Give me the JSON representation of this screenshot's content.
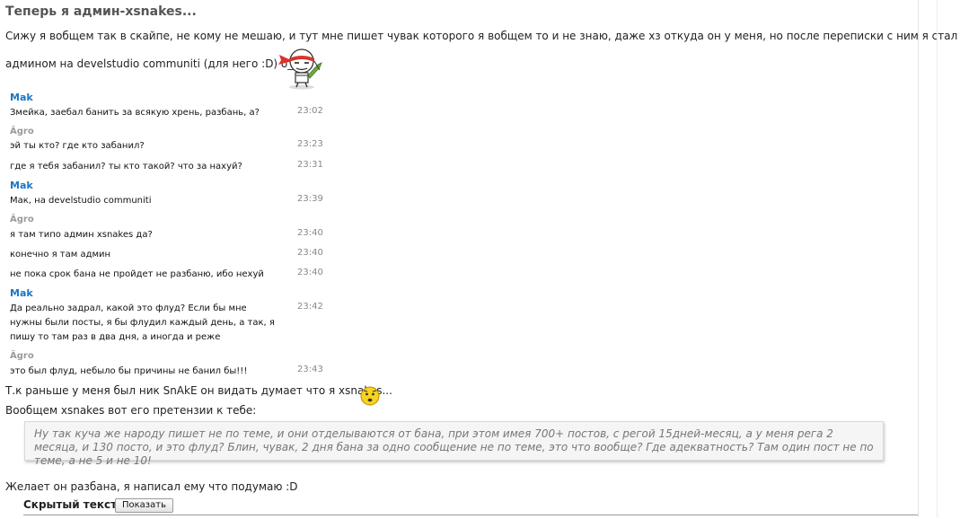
{
  "post": {
    "title": "Теперь я админ-xsnakes...",
    "intro_line1": "Сижу я вобщем так в скайпе, не кому не мешаю, и тут мне пишет чувак которого я вобщем то и не знаю, даже хз откуда он у меня, но после переписки с ним я стал",
    "intro_line2": "админом на develstudio communiti (для него :D) o_O",
    "after_chat_line": "Т.к раньше у меня был ник SnAkE он видать думает что я xsnakes...",
    "claims_line": "Вообщем xsnakes вот его претензии к тебе:",
    "quote": "Ну так куча же народу пишет не по теме, и они отделываются от бана, при этом имея 700+ постов, с регой 15дней-месяц, а у меня рега 2 месяца, и 130 посто, и это флуд? Блин, чувак, 2 дня бана за одно сообщение не по теме, это что вообще? Где адекватность? Там один пост не по теме, а не 5 и не 10!",
    "ending_line": "Желает он разбана, я написал ему что подумаю :D",
    "hidden_label": "Скрытый текст:",
    "show_button": "Показать"
  },
  "chat": {
    "nick_mak": "Mak",
    "nick_agro": "Ãgro",
    "messages": [
      {
        "text": "Змейка, заебал банить за всякую хрень, разбань, а?",
        "time": "23:02"
      },
      {
        "text": "эй ты кто? где кто забанил?",
        "time": "23:23"
      },
      {
        "text": "где я тебя забанил? ты кто такой? что за нахуй?",
        "time": "23:31"
      },
      {
        "text": "Мак, на develstudio communiti",
        "time": "23:39"
      },
      {
        "text": "я там типо админ xsnakes да?",
        "time": "23:40"
      },
      {
        "text": "конечно я там админ",
        "time": "23:40"
      },
      {
        "text": "не пока срок бана не пройдет не разбаню, ибо нехуй",
        "time": "23:40"
      },
      {
        "text": "Да реально задрал, какой это флуд? Если бы мне нужны были посты, я бы флудил каждый день, а так, я пишу то там раз в два дня, а иногда и реже",
        "time": "23:42"
      },
      {
        "text": "это был флуд, небыло бы причины не банил бы!!!",
        "time": "23:43"
      }
    ]
  },
  "icons": {
    "ninja": "ninja-smiley-icon",
    "smiley": "confused-smiley-icon"
  },
  "colors": {
    "mak_nick": "#1a76c8",
    "agro_nick": "#9a9a9a",
    "quote_text": "#777777",
    "quote_bg": "#f5f5f5"
  }
}
